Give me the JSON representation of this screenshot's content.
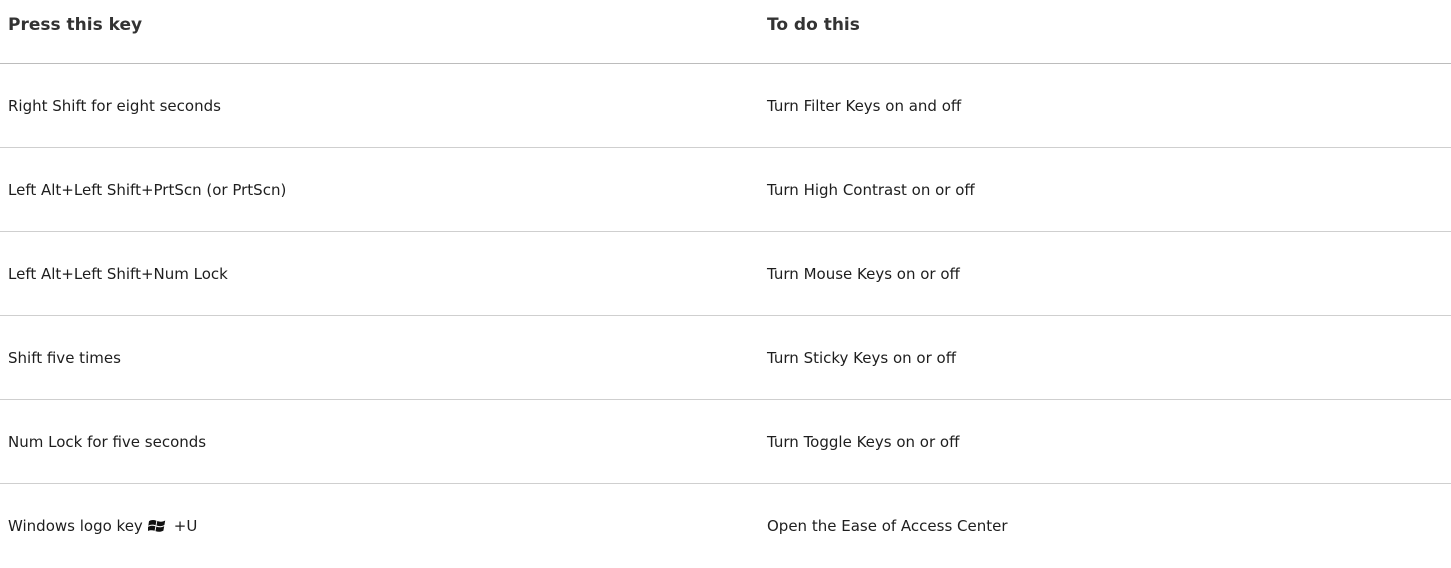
{
  "header": {
    "key_column": "Press this key",
    "action_column": "To do this"
  },
  "rows": [
    {
      "key": "Right Shift for eight seconds",
      "action": "Turn Filter Keys on and off"
    },
    {
      "key": "Left Alt+Left Shift+PrtScn (or PrtScn)",
      "action": "Turn High Contrast on or off"
    },
    {
      "key": "Left Alt+Left Shift+Num Lock",
      "action": "Turn Mouse Keys on or off"
    },
    {
      "key": "Shift five times",
      "action": "Turn Sticky Keys on or off"
    },
    {
      "key": "Num Lock for five seconds",
      "action": "Turn Toggle Keys on or off"
    },
    {
      "key_prefix": "Windows logo key",
      "key_icon": "windows-logo-icon",
      "key_suffix": "+U",
      "action": "Open the Ease of Access Center"
    }
  ]
}
